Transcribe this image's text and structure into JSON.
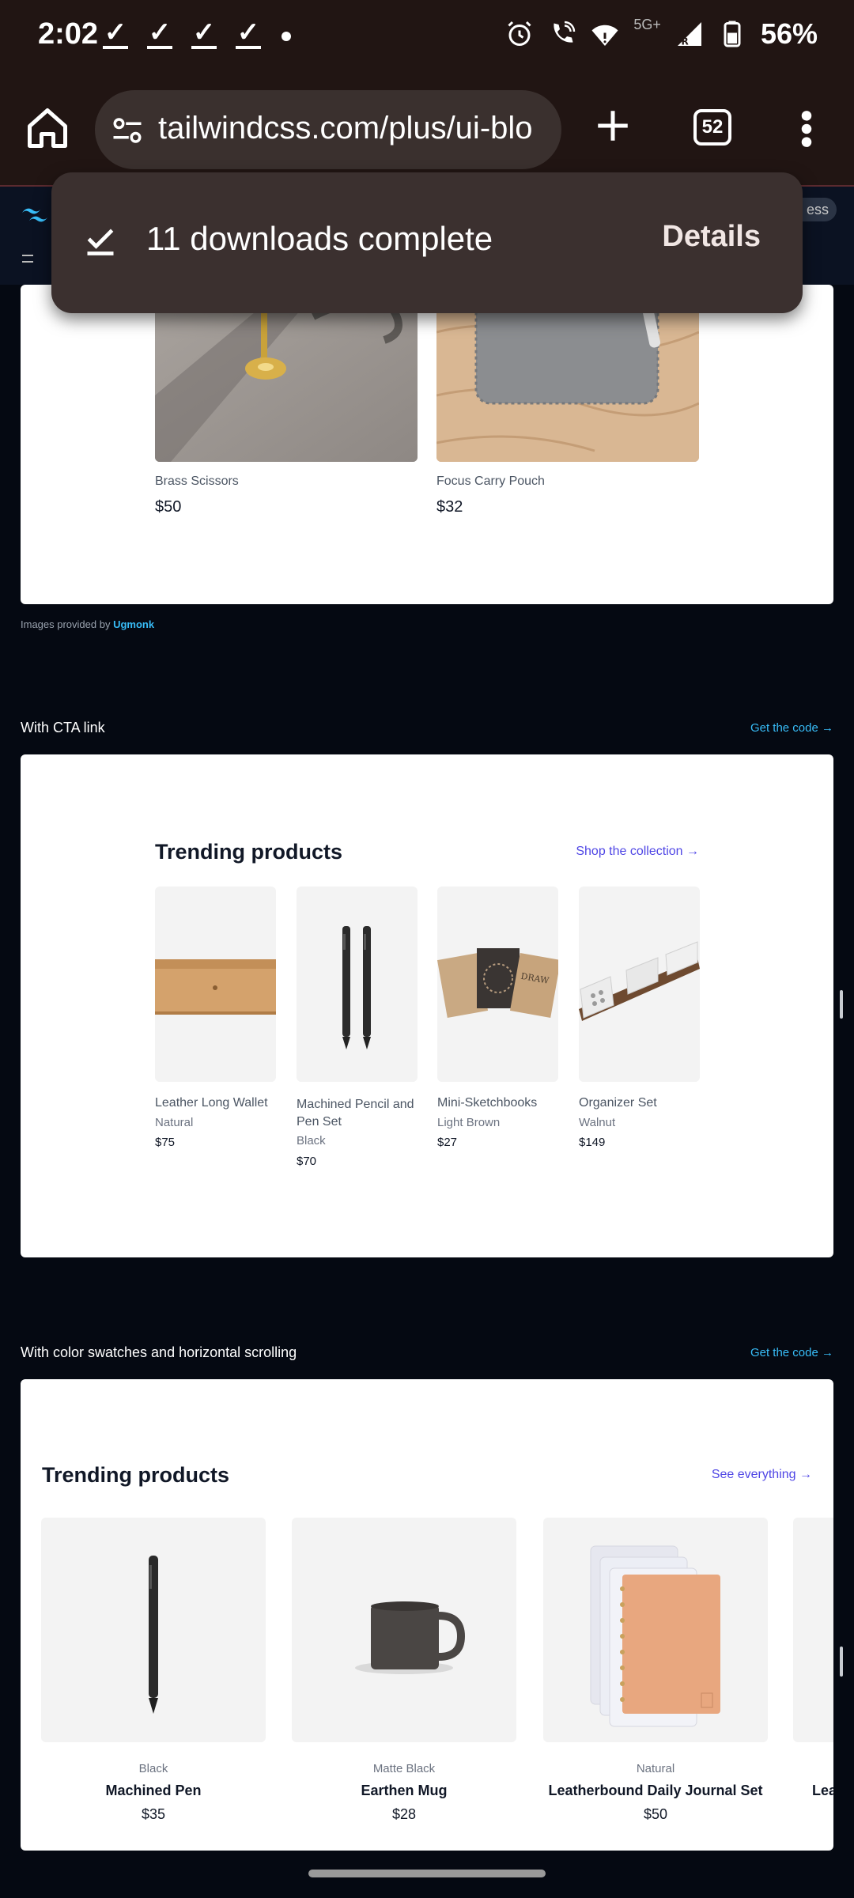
{
  "status": {
    "time": "2:02",
    "network_badge": "5G+",
    "battery": "56%"
  },
  "browser": {
    "url": "tailwindcss.com/plus/ui-blo",
    "tab_count": "52"
  },
  "snackbar": {
    "message": "11 downloads complete",
    "action": "Details"
  },
  "header_pill": "ess",
  "section1": {
    "products": [
      {
        "name": "Brass Scissors",
        "price": "$50"
      },
      {
        "name": "Focus Carry Pouch",
        "price": "$32"
      }
    ],
    "credit_prefix": "Images provided by",
    "credit_link": "Ugmonk"
  },
  "section2": {
    "label": "With CTA link",
    "code_link": "Get the code →",
    "title": "Trending products",
    "shop_link": "Shop the collection →",
    "products": [
      {
        "name": "Leather Long Wallet",
        "color": "Natural",
        "price": "$75"
      },
      {
        "name": "Machined Pencil and Pen Set",
        "color": "Black",
        "price": "$70"
      },
      {
        "name": "Mini-Sketchbooks",
        "color": "Light Brown",
        "price": "$27"
      },
      {
        "name": "Organizer Set",
        "color": "Walnut",
        "price": "$149"
      }
    ]
  },
  "section3": {
    "label": "With color swatches and horizontal scrolling",
    "code_link": "Get the code →",
    "title": "Trending products",
    "see_link": "See everything →",
    "products": [
      {
        "color": "Black",
        "name": "Machined Pen",
        "price": "$35"
      },
      {
        "color": "Matte Black",
        "name": "Earthen Mug",
        "price": "$28"
      },
      {
        "color": "Natural",
        "name": "Leatherbound Daily Journal Set",
        "price": "$50"
      },
      {
        "color": "",
        "name": "Lea",
        "price": ""
      }
    ]
  },
  "colors": {
    "accent_link": "#38bdf8",
    "indigo_link": "#4f46e5",
    "page_bg": "#050912",
    "chrome_bg": "#211513"
  }
}
